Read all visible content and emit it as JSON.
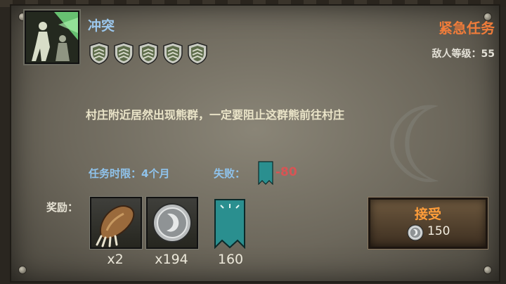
{
  "mission": {
    "title": "冲突",
    "type_label": "紧急任务",
    "enemy_level": "敌人等级：55",
    "difficulty_shields": 5,
    "description": "村庄附近居然出现熊群，一定要阻止这群熊前往村庄",
    "time_limit": "任务时限：4个月",
    "fail_label": "失败：",
    "fail_value": "-80"
  },
  "rewards": {
    "label": "奖励：",
    "items": [
      {
        "icon": "bear-claw-icon",
        "count": "x2"
      },
      {
        "icon": "silver-coin-icon",
        "count": "x194"
      },
      {
        "icon": "faction-banner-icon",
        "count": "160"
      }
    ]
  },
  "accept_button": {
    "label": "接受",
    "cost": "150"
  },
  "colors": {
    "title": "#9cc8ee",
    "urgent": "#f07c3a",
    "fail": "#d85454",
    "accept": "#ff9d3a",
    "banner": "#2a8f8f"
  }
}
